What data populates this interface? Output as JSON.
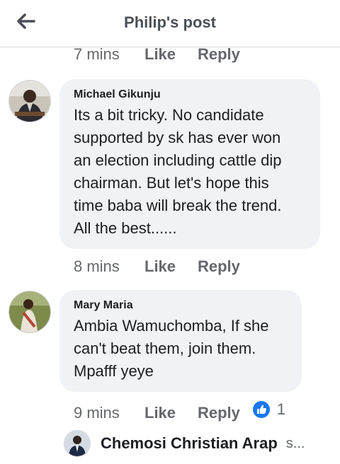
{
  "header": {
    "title": "Philip's post",
    "back_icon": "arrow-left-icon"
  },
  "top_meta": {
    "time": "7 mins",
    "like": "Like",
    "reply": "Reply"
  },
  "comments": [
    {
      "author": "Michael Gikunju",
      "lines": [
        "Its  a bit tricky. No candidate",
        "supported by sk  has ever won",
        "an election including cattle dip",
        "chairman. But let's hope this",
        "time baba will break the trend.",
        "All the best......"
      ],
      "time": "8 mins",
      "like": "Like",
      "reply": "Reply"
    },
    {
      "author": "Mary Maria",
      "lines": [
        "Ambia Wamuchomba, If she",
        "can't beat them, join them.",
        "Mpafff yeye"
      ],
      "time": "9 mins",
      "like": "Like",
      "reply": "Reply",
      "reaction": {
        "icon": "like-thumb-icon",
        "count": "1",
        "color": "#1877f2"
      }
    }
  ],
  "next_reply": {
    "author": "Chemosi Christian Arap",
    "snippet": "s..."
  }
}
